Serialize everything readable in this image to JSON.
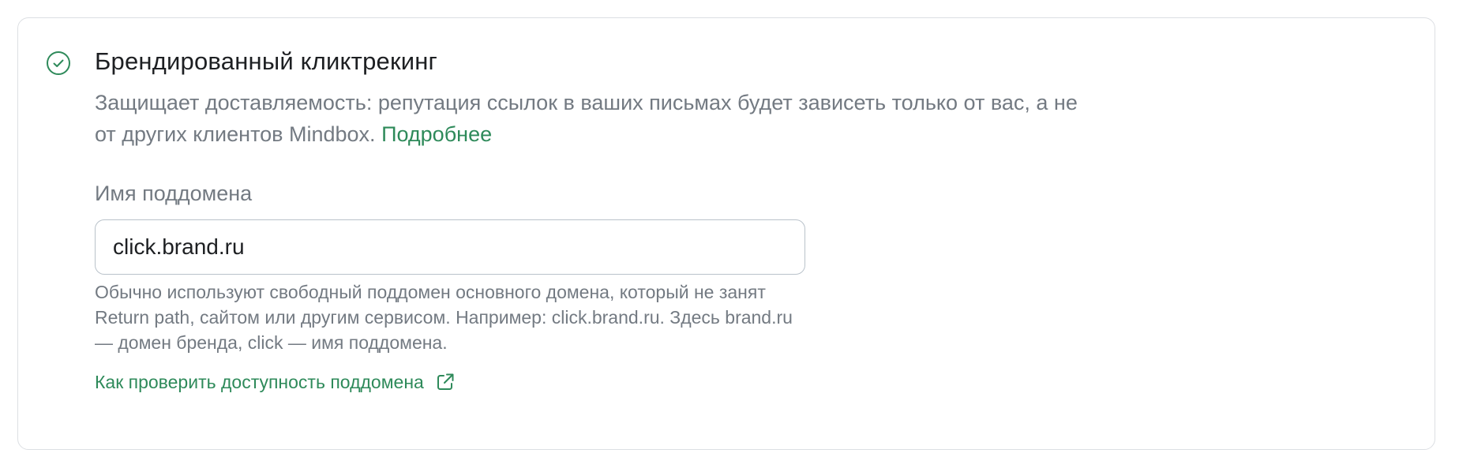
{
  "section": {
    "title": "Брендированный кликтрекинг",
    "description_text": "Защищает доставляемость: репутация ссылок в ваших письмах будет зависеть только от вас, а не от других клиентов Mindbox.",
    "more_link": "Подробнее",
    "status_icon": "check-circle-icon"
  },
  "subdomain_field": {
    "label": "Имя поддомена",
    "value": "click.brand.ru",
    "hint": "Обычно используют свободный поддомен основного домена, который не занят Return path, сайтом или другим сервисом. Например: click.brand.ru. Здесь brand.ru — домен бренда, click — имя поддомена.",
    "check_link": "Как проверить доступность поддомена",
    "check_link_icon": "external-link-icon"
  },
  "colors": {
    "accent": "#2e8a5a",
    "text_primary": "#1d1f22",
    "text_secondary": "#737a82",
    "border": "#dcdfe3",
    "input_border": "#b9c2ca"
  }
}
